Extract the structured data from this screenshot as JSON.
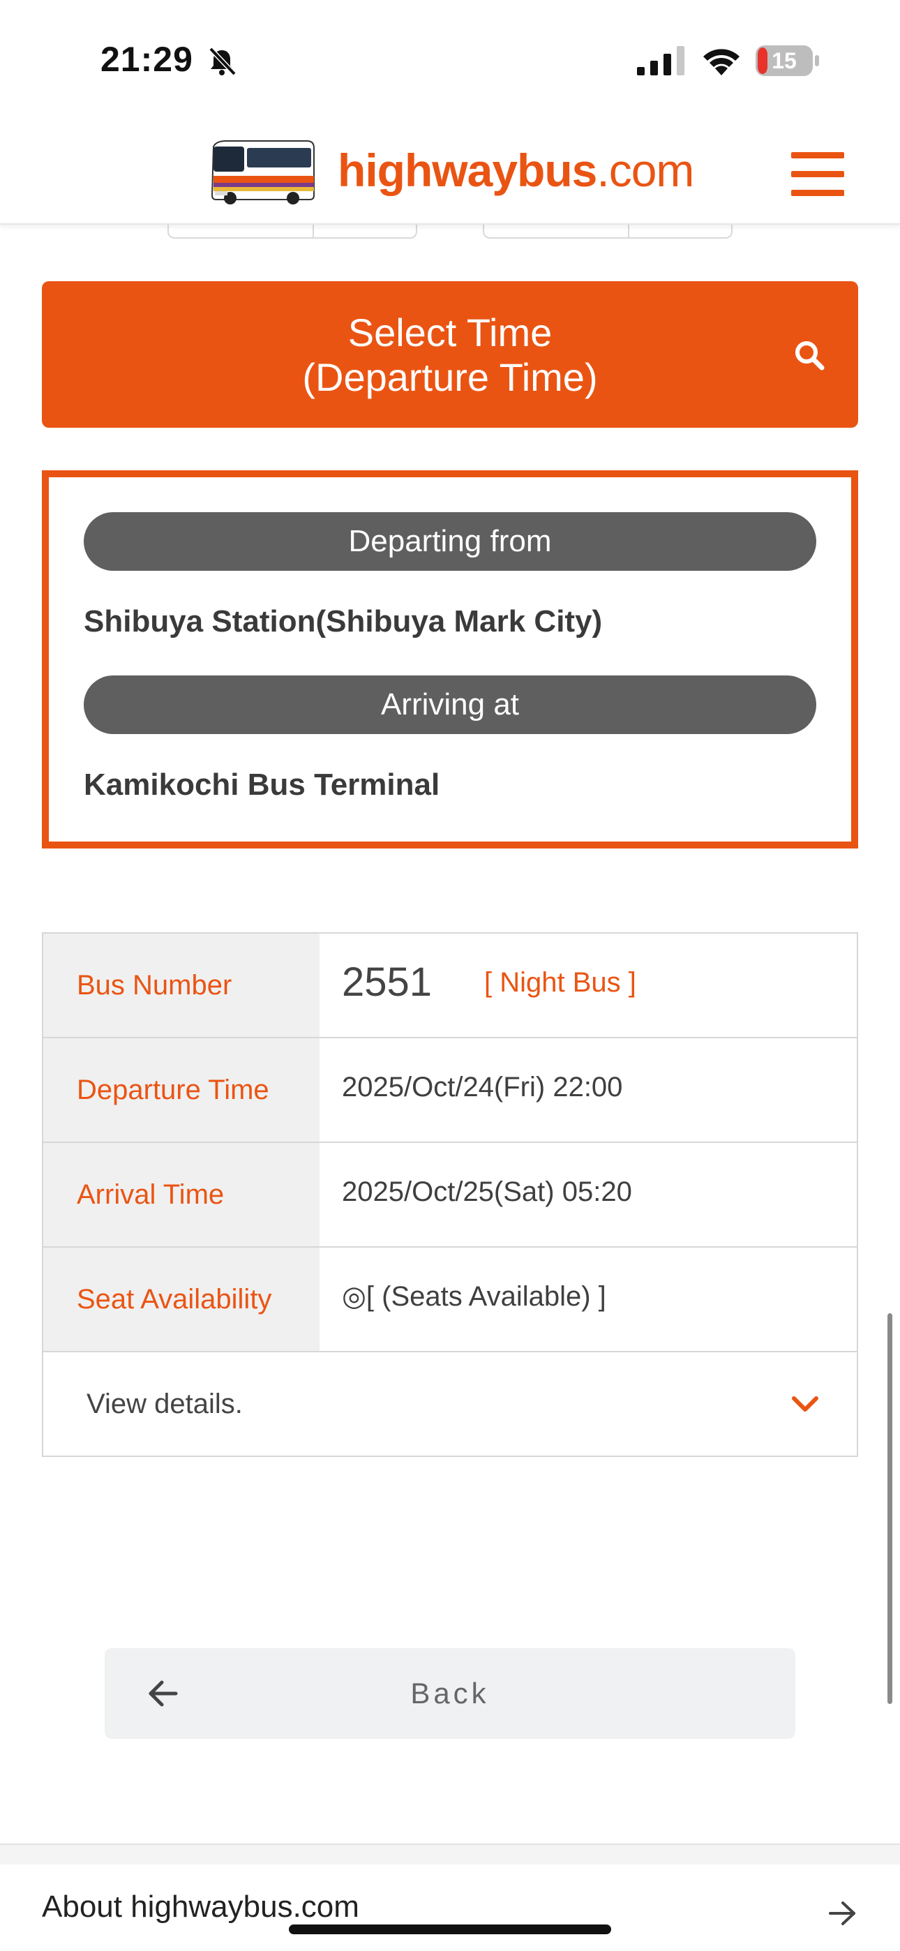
{
  "status_bar": {
    "time": "21:29",
    "battery_level": "15"
  },
  "header": {
    "logo_main": "highwaybus",
    "logo_suffix": ".com",
    "menu_icon": "hamburger-icon"
  },
  "search": {
    "button_line1": "Select Time",
    "button_line2": "(Departure Time)",
    "icon": "search-icon"
  },
  "route": {
    "departing_label": "Departing from",
    "departing_value": "Shibuya Station(Shibuya Mark City)",
    "arriving_label": "Arriving at",
    "arriving_value": "Kamikochi Bus Terminal"
  },
  "bus_info": {
    "rows": [
      {
        "label": "Bus Number",
        "value": "2551",
        "tag": "[ Night Bus ]"
      },
      {
        "label": "Departure Time",
        "value": "2025/Oct/24(Fri) 22:00"
      },
      {
        "label": "Arrival Time",
        "value": "2025/Oct/25(Sat) 05:20"
      },
      {
        "label": "Seat Availability",
        "value": "◎[ (Seats Available) ]"
      }
    ],
    "details_label": "View details."
  },
  "back": {
    "label": "Back"
  },
  "footer": {
    "about_label": "About highwaybus.com"
  },
  "colors": {
    "accent": "#ea5413",
    "pill": "#5f5f5f",
    "table_head_bg": "#f0f0f0",
    "back_bg": "#f0f1f3"
  }
}
